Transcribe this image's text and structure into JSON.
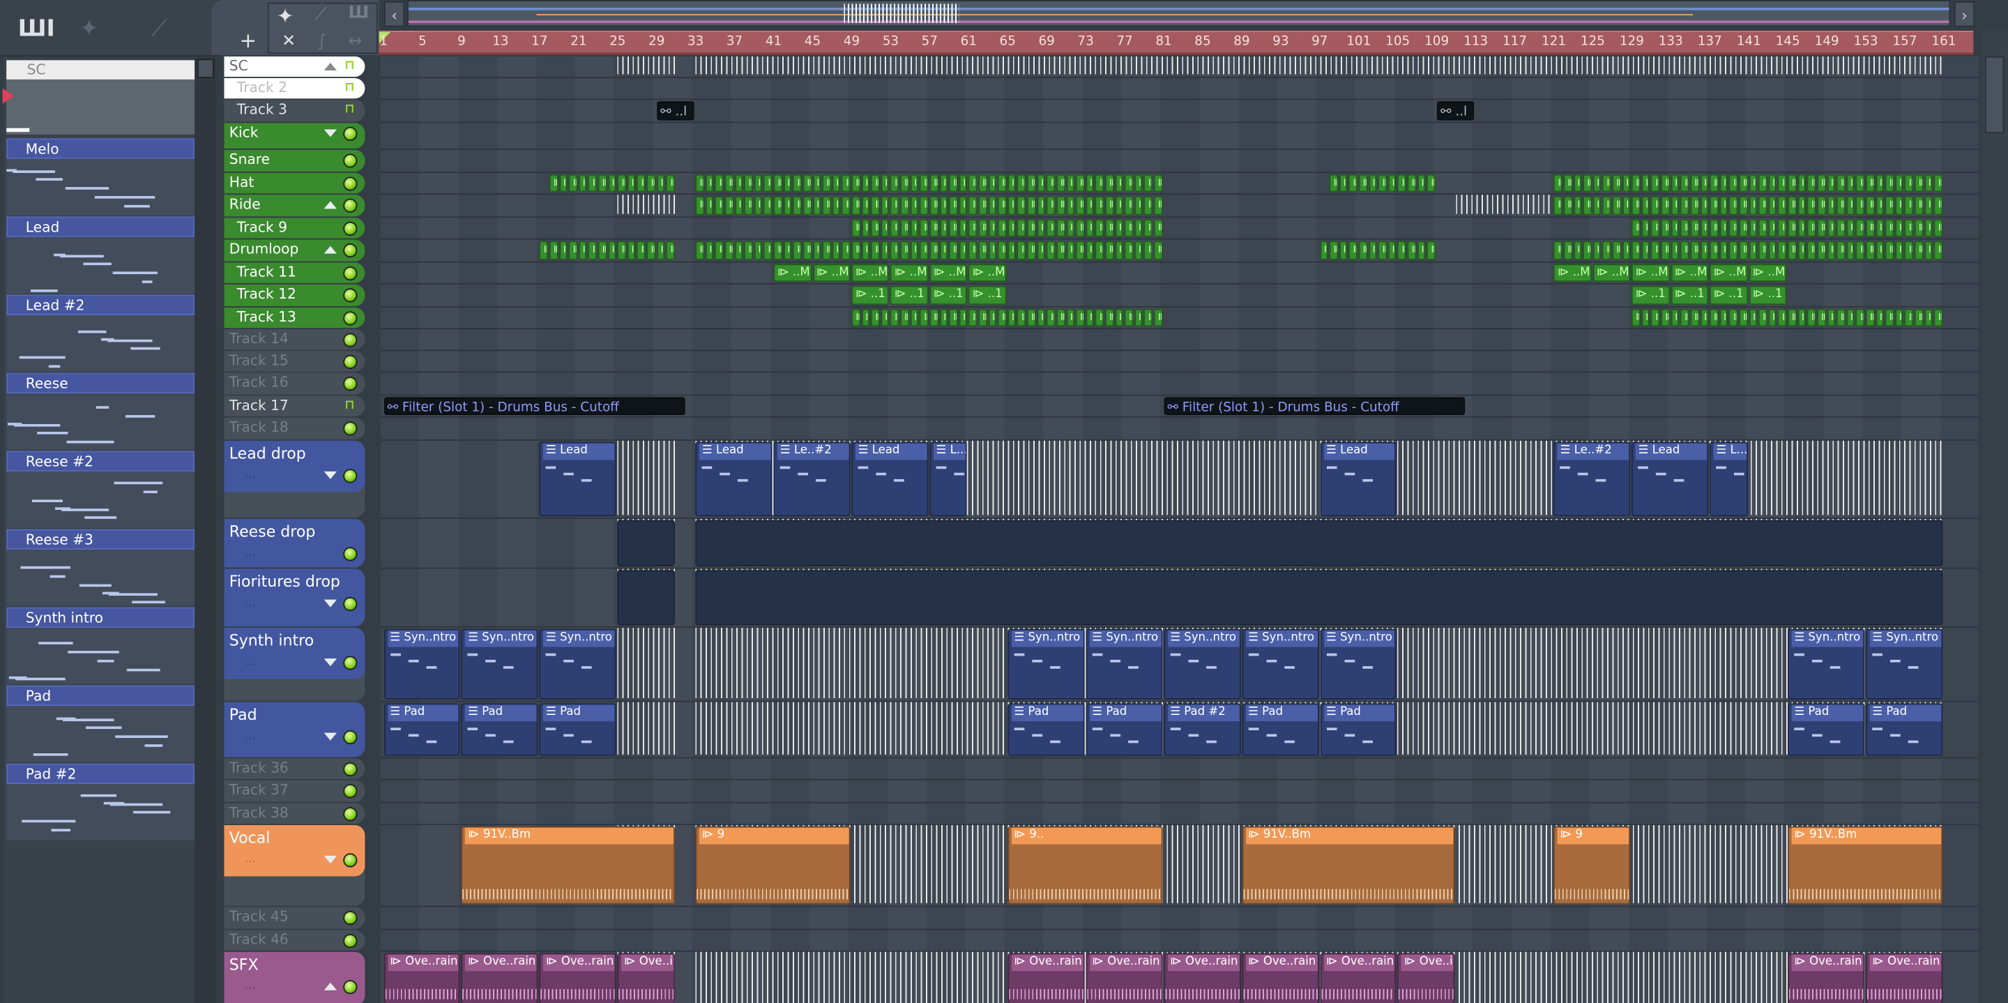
{
  "toolbar": {
    "add_icon": "plus-icon",
    "icons": [
      "piano-roll-icon",
      "audio-wave-icon",
      "automation-icon",
      "cut-icon",
      "curve-icon",
      "stretch-icon"
    ]
  },
  "pattern_list": {
    "header": "SC",
    "items": [
      "Melo",
      "Lead",
      "Lead #2",
      "Reese",
      "Reese #2",
      "Reese #3",
      "Synth intro",
      "Pad",
      "Pad #2"
    ]
  },
  "ruler": {
    "bars": [
      1,
      5,
      9,
      13,
      17,
      21,
      25,
      29,
      33,
      37,
      41,
      45,
      49,
      53,
      57,
      61,
      65,
      69,
      73,
      77,
      81,
      85,
      89,
      93,
      97,
      101,
      105,
      109,
      113,
      117,
      121,
      125,
      129,
      133,
      137,
      141,
      145,
      149,
      153,
      157,
      161
    ]
  },
  "colors": {
    "drums": "#3a8a2e",
    "synth": "#4357a0",
    "vocal": "#f0955a",
    "sfx": "#9a5a8e",
    "empty": "#474f58",
    "ruler": "#a45a5e"
  },
  "tracks": [
    {
      "name": "SC",
      "kind": "white",
      "arrow": "up",
      "icon": "lock",
      "ghost": [
        [
          25,
          31
        ],
        [
          33,
          161
        ]
      ]
    },
    {
      "name": "Track 2",
      "kind": "whitesub",
      "icon": "lock"
    },
    {
      "name": "Track 3",
      "kind": "sub",
      "icon": "lock",
      "clips": [
        {
          "s": 29,
          "e": 33,
          "label": "..l",
          "c": "auto"
        },
        {
          "s": 109,
          "e": 113,
          "label": "..l",
          "c": "auto"
        }
      ]
    },
    {
      "name": "Kick",
      "kind": "drums",
      "arrow": "down",
      "icon": "led"
    },
    {
      "name": "Snare",
      "kind": "drums",
      "icon": "led"
    },
    {
      "name": "Hat",
      "kind": "drums",
      "icon": "led",
      "clips": [
        {
          "s": 18,
          "e": 31,
          "seg": 1,
          "c": "green"
        },
        {
          "s": 33,
          "e": 81,
          "seg": 1,
          "c": "green"
        },
        {
          "s": 98,
          "e": 109,
          "seg": 1,
          "c": "green"
        },
        {
          "s": 121,
          "e": 161,
          "seg": 1,
          "c": "green"
        }
      ]
    },
    {
      "name": "Ride",
      "kind": "drums",
      "arrow": "up",
      "icon": "led",
      "ghost": [
        [
          25,
          31
        ],
        [
          111,
          121
        ]
      ],
      "clips": [
        {
          "s": 33,
          "e": 81,
          "seg": 1,
          "c": "green"
        },
        {
          "s": 121,
          "e": 161,
          "seg": 1,
          "c": "green"
        }
      ]
    },
    {
      "name": "Track 9",
      "kind": "drumsub",
      "icon": "led",
      "clips": [
        {
          "s": 49,
          "e": 81,
          "seg": 1,
          "c": "green"
        },
        {
          "s": 129,
          "e": 161,
          "seg": 1,
          "c": "green"
        }
      ]
    },
    {
      "name": "Drumloop",
      "kind": "drums",
      "arrow": "up",
      "icon": "led",
      "clips": [
        {
          "s": 17,
          "e": 31,
          "seg": 1,
          "c": "green"
        },
        {
          "s": 33,
          "e": 81,
          "seg": 1,
          "c": "green"
        },
        {
          "s": 97,
          "e": 109,
          "seg": 1,
          "c": "green"
        },
        {
          "s": 121,
          "e": 161,
          "seg": 1,
          "c": "green"
        }
      ]
    },
    {
      "name": "Track 11",
      "kind": "drumsub",
      "icon": "led",
      "clips": [
        {
          "s": 41,
          "e": 65,
          "seg": 4,
          "label": "..M",
          "c": "green"
        },
        {
          "s": 121,
          "e": 145,
          "seg": 4,
          "label": "..M",
          "c": "green"
        }
      ]
    },
    {
      "name": "Track 12",
      "kind": "drumsub",
      "icon": "led",
      "clips": [
        {
          "s": 49,
          "e": 65,
          "seg": 4,
          "label": "..1",
          "c": "green"
        },
        {
          "s": 129,
          "e": 145,
          "seg": 4,
          "label": "..1",
          "c": "green"
        }
      ]
    },
    {
      "name": "Track 13",
      "kind": "drumsub",
      "icon": "led",
      "clips": [
        {
          "s": 49,
          "e": 81,
          "seg": 1,
          "c": "green"
        },
        {
          "s": 129,
          "e": 161,
          "seg": 1,
          "c": "green"
        }
      ]
    },
    {
      "name": "Track 14",
      "kind": "empty",
      "icon": "led"
    },
    {
      "name": "Track 15",
      "kind": "empty",
      "icon": "led"
    },
    {
      "name": "Track 16",
      "kind": "empty",
      "icon": "led"
    },
    {
      "name": "Track 17",
      "kind": "emptylight",
      "icon": "lock",
      "clips": [
        {
          "s": 1,
          "e": 32,
          "label": "Filter (Slot 1) - Drums Bus - Cutoff",
          "c": "auto"
        },
        {
          "s": 81,
          "e": 112,
          "label": "Filter (Slot 1) - Drums Bus - Cutoff",
          "c": "auto"
        }
      ]
    },
    {
      "name": "Track 18",
      "kind": "empty",
      "icon": "led"
    },
    {
      "name": "Lead drop",
      "kind": "synth",
      "arrow": "down",
      "icon": "led",
      "dots": "...",
      "ghost": [
        [
          25,
          31
        ],
        [
          33,
          161
        ]
      ],
      "clips": [
        {
          "s": 17,
          "e": 25,
          "label": "Lead",
          "c": "blue"
        },
        {
          "s": 33,
          "e": 41,
          "label": "Lead",
          "c": "blue"
        },
        {
          "s": 41,
          "e": 49,
          "label": "Le..#2",
          "c": "blue"
        },
        {
          "s": 49,
          "e": 57,
          "label": "Lead",
          "c": "blue"
        },
        {
          "s": 57,
          "e": 61,
          "label": "L...",
          "c": "blue"
        },
        {
          "s": 97,
          "e": 105,
          "label": "Lead",
          "c": "blue"
        },
        {
          "s": 121,
          "e": 129,
          "label": "Le..#2",
          "c": "blue"
        },
        {
          "s": 129,
          "e": 137,
          "label": "Lead",
          "c": "blue"
        },
        {
          "s": 137,
          "e": 141,
          "label": "L...",
          "c": "blue"
        }
      ]
    },
    {
      "name": "Reese drop",
      "kind": "synthfull",
      "icon": "led",
      "dots": "...",
      "ghost": [
        [
          25,
          31
        ],
        [
          33,
          161
        ]
      ],
      "clips": [
        {
          "s": 25,
          "e": 31,
          "c": "dark"
        },
        {
          "s": 33,
          "e": 161,
          "c": "dark"
        }
      ]
    },
    {
      "name": "Fioritures drop",
      "kind": "synthfull",
      "arrow": "down",
      "icon": "led",
      "dots": "...",
      "ghost": [
        [
          25,
          31
        ],
        [
          33,
          161
        ]
      ],
      "clips": [
        {
          "s": 25,
          "e": 31,
          "c": "dark"
        },
        {
          "s": 33,
          "e": 161,
          "c": "dark"
        }
      ]
    },
    {
      "name": "Synth intro",
      "kind": "synth",
      "arrow": "down",
      "icon": "led",
      "dots": "...",
      "ghost": [
        [
          25,
          31
        ],
        [
          33,
          161
        ]
      ],
      "clips": [
        {
          "s": 1,
          "e": 9,
          "label": "Syn..ntro",
          "c": "blue"
        },
        {
          "s": 9,
          "e": 17,
          "label": "Syn..ntro",
          "c": "blue"
        },
        {
          "s": 17,
          "e": 25,
          "label": "Syn..ntro",
          "c": "blue"
        },
        {
          "s": 65,
          "e": 73,
          "label": "Syn..ntro",
          "c": "blue"
        },
        {
          "s": 73,
          "e": 81,
          "label": "Syn..ntro",
          "c": "blue"
        },
        {
          "s": 81,
          "e": 89,
          "label": "Syn..ntro",
          "c": "blue"
        },
        {
          "s": 89,
          "e": 97,
          "label": "Syn..ntro",
          "c": "blue"
        },
        {
          "s": 97,
          "e": 105,
          "label": "Syn..ntro",
          "c": "blue"
        },
        {
          "s": 145,
          "e": 153,
          "label": "Syn..ntro",
          "c": "blue"
        },
        {
          "s": 153,
          "e": 161,
          "label": "Syn..ntro",
          "c": "blue"
        }
      ]
    },
    {
      "name": "Pad",
      "kind": "synthfull",
      "arrow": "down",
      "icon": "led",
      "dots": "...",
      "ghost": [
        [
          25,
          31
        ],
        [
          33,
          161
        ]
      ],
      "clips": [
        {
          "s": 1,
          "e": 9,
          "label": "Pad",
          "c": "blue"
        },
        {
          "s": 9,
          "e": 17,
          "label": "Pad",
          "c": "blue"
        },
        {
          "s": 17,
          "e": 25,
          "label": "Pad",
          "c": "blue"
        },
        {
          "s": 65,
          "e": 73,
          "label": "Pad",
          "c": "blue"
        },
        {
          "s": 73,
          "e": 81,
          "label": "Pad",
          "c": "blue"
        },
        {
          "s": 81,
          "e": 89,
          "label": "Pad #2",
          "c": "blue"
        },
        {
          "s": 89,
          "e": 97,
          "label": "Pad",
          "c": "blue"
        },
        {
          "s": 97,
          "e": 105,
          "label": "Pad",
          "c": "blue"
        },
        {
          "s": 145,
          "e": 153,
          "label": "Pad",
          "c": "blue"
        },
        {
          "s": 153,
          "e": 161,
          "label": "Pad",
          "c": "blue"
        }
      ]
    },
    {
      "name": "Track 36",
      "kind": "empty",
      "icon": "led"
    },
    {
      "name": "Track 37",
      "kind": "empty",
      "icon": "led"
    },
    {
      "name": "Track 38",
      "kind": "empty",
      "icon": "led"
    },
    {
      "name": "Vocal",
      "kind": "vocal",
      "arrow": "down",
      "icon": "led",
      "dots": "...",
      "ghost": [
        [
          25,
          31
        ],
        [
          33,
          161
        ]
      ],
      "clips": [
        {
          "s": 9,
          "e": 31,
          "label": "91V..Bm",
          "c": "orange"
        },
        {
          "s": 33,
          "e": 49,
          "label": "9",
          "c": "orange"
        },
        {
          "s": 65,
          "e": 81,
          "label": "9..",
          "c": "orange"
        },
        {
          "s": 89,
          "e": 111,
          "label": "91V..Bm",
          "c": "orange"
        },
        {
          "s": 121,
          "e": 129,
          "label": "9",
          "c": "orange"
        },
        {
          "s": 145,
          "e": 161,
          "label": "91V..Bm",
          "c": "orange"
        }
      ]
    },
    {
      "name": "Track 45",
      "kind": "empty",
      "icon": "led"
    },
    {
      "name": "Track 46",
      "kind": "empty",
      "icon": "led"
    },
    {
      "name": "SFX",
      "kind": "sfx",
      "arrow": "up",
      "icon": "led",
      "dots": "...",
      "ghost": [
        [
          25,
          31
        ],
        [
          33,
          161
        ]
      ],
      "clips": [
        {
          "s": 1,
          "e": 9,
          "label": "Ove..rain",
          "c": "purple"
        },
        {
          "s": 9,
          "e": 17,
          "label": "Ove..rain",
          "c": "purple"
        },
        {
          "s": 17,
          "e": 25,
          "label": "Ove..rain",
          "c": "purple"
        },
        {
          "s": 25,
          "e": 31,
          "label": "Ove..in",
          "c": "purple"
        },
        {
          "s": 65,
          "e": 73,
          "label": "Ove..rain",
          "c": "purple"
        },
        {
          "s": 73,
          "e": 81,
          "label": "Ove..rain",
          "c": "purple"
        },
        {
          "s": 81,
          "e": 89,
          "label": "Ove..rain",
          "c": "purple"
        },
        {
          "s": 89,
          "e": 97,
          "label": "Ove..rain",
          "c": "purple"
        },
        {
          "s": 97,
          "e": 105,
          "label": "Ove..rain",
          "c": "purple"
        },
        {
          "s": 105,
          "e": 111,
          "label": "Ove..in",
          "c": "purple"
        },
        {
          "s": 145,
          "e": 153,
          "label": "Ove..rain",
          "c": "purple"
        },
        {
          "s": 153,
          "e": 161,
          "label": "Ove..rain",
          "c": "purple"
        }
      ]
    }
  ]
}
